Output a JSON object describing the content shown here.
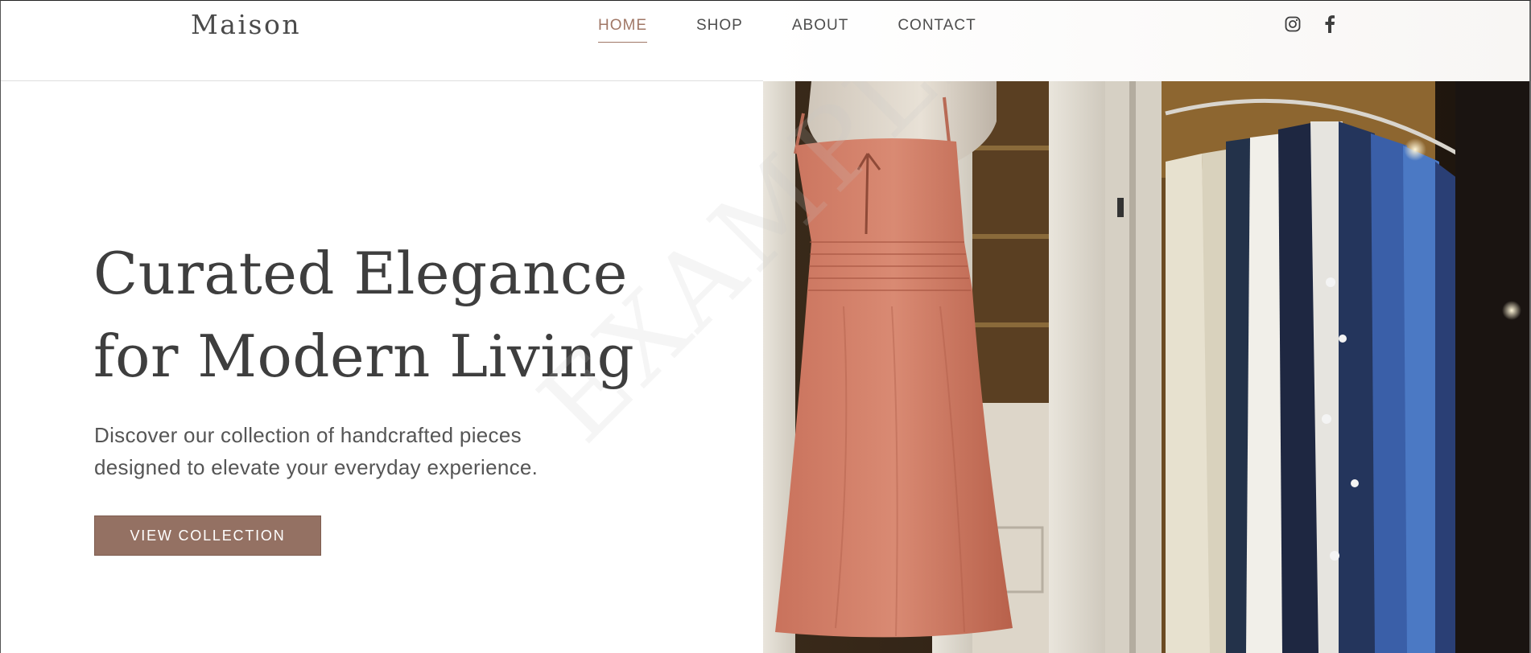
{
  "header": {
    "logo": "Maison",
    "nav": [
      {
        "label": "HOME",
        "active": true
      },
      {
        "label": "SHOP",
        "active": false
      },
      {
        "label": "ABOUT",
        "active": false
      },
      {
        "label": "CONTACT",
        "active": false
      }
    ],
    "social_icons": [
      "instagram-icon",
      "facebook-icon"
    ]
  },
  "hero": {
    "title_line1": "Curated Elegance",
    "title_line2": "for Modern Living",
    "subtitle_line1": "Discover our collection of handcrafted pieces",
    "subtitle_line2": "designed to elevate your everyday experience.",
    "cta_label": "VIEW COLLECTION",
    "watermark": "EXAMPLE"
  },
  "colors": {
    "accent": "#a07766",
    "button": "#947163",
    "text": "#3e3e3e"
  }
}
